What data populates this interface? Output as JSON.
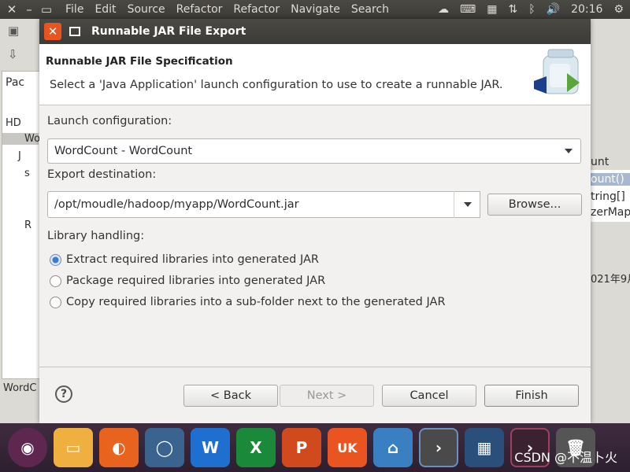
{
  "menubar": {
    "menus": [
      "File",
      "Edit",
      "Source",
      "Refactor",
      "Refactor",
      "Navigate",
      "Search"
    ],
    "clock": "20:16",
    "icons": [
      "close-icon",
      "minimize-icon",
      "restore-icon",
      "weather-icon",
      "keyboard-icon",
      "calendar-icon",
      "network-icon",
      "bluetooth-icon",
      "volume-icon"
    ]
  },
  "background": {
    "left_tab": "Pac",
    "left_tree": [
      "HD",
      "Wo",
      "J",
      "s",
      "",
      "R"
    ],
    "left_status": "WordC",
    "right_lines": [
      "unt",
      "ount()",
      "tring[]",
      "zerMap",
      "021年9月"
    ]
  },
  "dialog": {
    "title": "Runnable JAR File Export",
    "header_title": "Runnable JAR File Specification",
    "header_desc": "Select a 'Java Application' launch configuration to use to create a runnable JAR.",
    "launch_label": "Launch configuration:",
    "launch_value": "WordCount - WordCount",
    "export_label": "Export destination:",
    "export_value": "/opt/moudle/hadoop/myapp/WordCount.jar",
    "browse_label": "Browse...",
    "library_label": "Library handling:",
    "library_options": [
      {
        "label": "Extract required libraries into generated JAR",
        "checked": true
      },
      {
        "label": "Package required libraries into generated JAR",
        "checked": false
      },
      {
        "label": "Copy required libraries into a sub-folder next to the generated JAR",
        "checked": false
      }
    ],
    "buttons": {
      "back": "< Back",
      "next": "Next >",
      "cancel": "Cancel",
      "finish": "Finish"
    },
    "help": "?"
  },
  "dock": {
    "apps": [
      {
        "name": "ubuntu-icon",
        "color": "#4a2f4a"
      },
      {
        "name": "files-icon",
        "color": "#e8a13a"
      },
      {
        "name": "firefox-icon",
        "color": "#e3641e"
      },
      {
        "name": "browser-icon",
        "color": "#3c5f8c"
      },
      {
        "name": "word-icon",
        "color": "#1e6fd0"
      },
      {
        "name": "excel-icon",
        "color": "#1a8a3a"
      },
      {
        "name": "powerpoint-icon",
        "color": "#d04a1e"
      },
      {
        "name": "uk-store-icon",
        "color": "#e95420"
      },
      {
        "name": "remote-icon",
        "color": "#3a7fc1"
      },
      {
        "name": "eclipse-icon",
        "color": "#3d3d3d"
      },
      {
        "name": "workspace-icon",
        "color": "#2a4f7a"
      },
      {
        "name": "terminal-icon",
        "color": "#3b2230"
      },
      {
        "name": "trash-icon",
        "color": "#555555"
      }
    ],
    "ubuntu_label": "",
    "word_label": "W",
    "excel_label": "X",
    "ppt_label": "P",
    "uk_label": "UK",
    "watermark": "CSDN @不温卜火"
  }
}
